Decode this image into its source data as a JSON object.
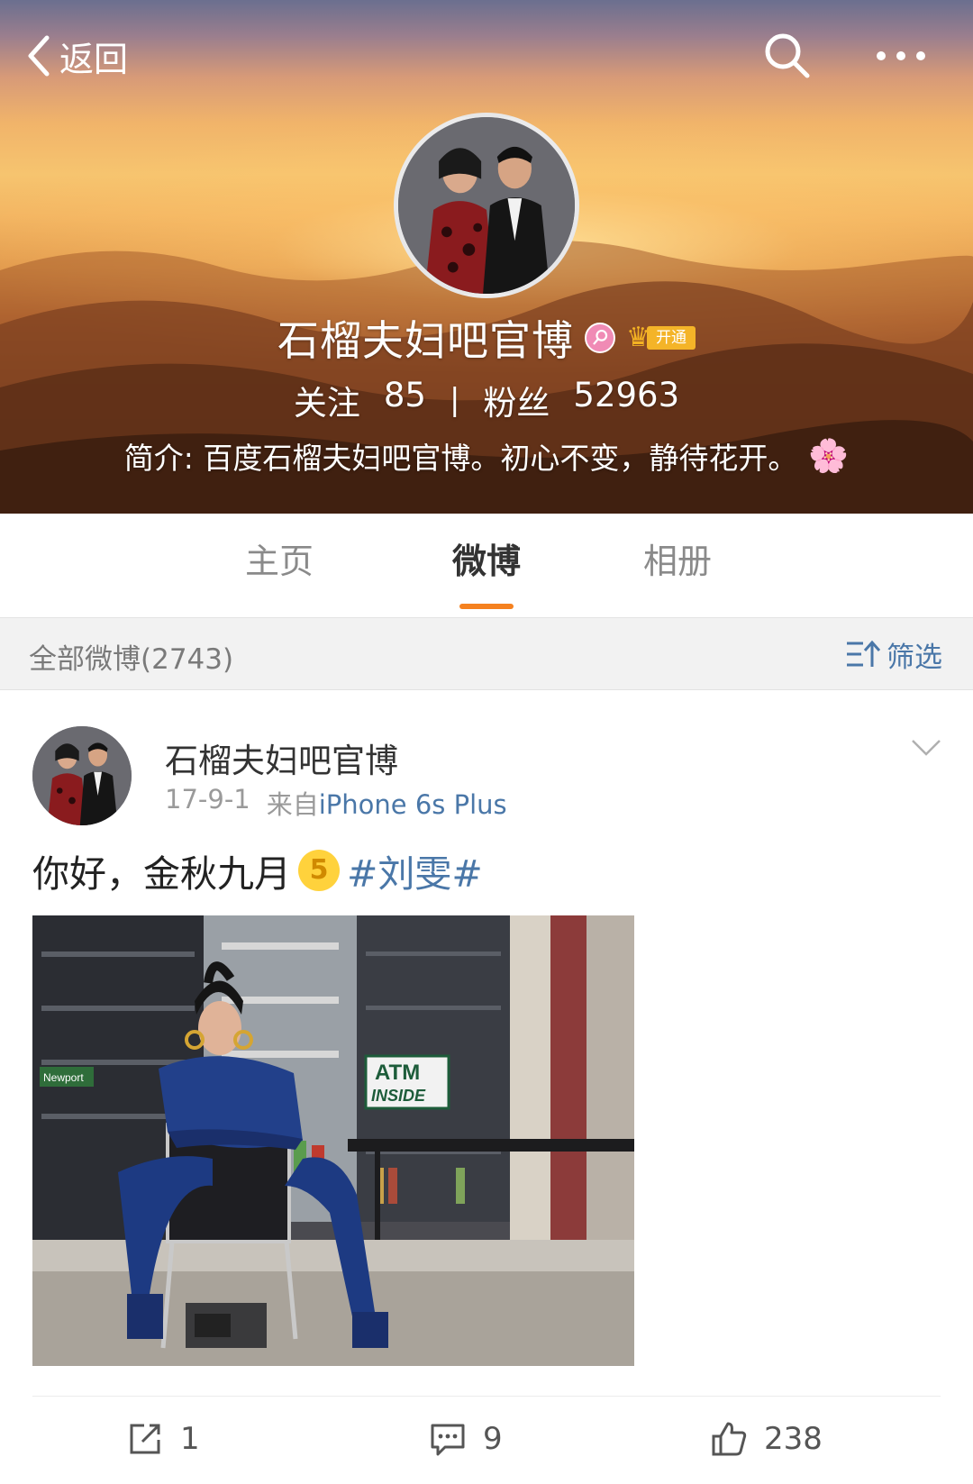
{
  "nav": {
    "back_label": "返回"
  },
  "profile": {
    "name": "石榴夫妇吧官博",
    "member_tag": "开通",
    "following_label": "关注",
    "following_count": "85",
    "stats_divider": "|",
    "followers_label": "粉丝",
    "followers_count": "52963",
    "bio": "简介: 百度石榴夫妇吧官博。初心不变，静待花开。",
    "bio_emoji": "🌸"
  },
  "tabs": [
    {
      "label": "主页",
      "active": false
    },
    {
      "label": "微博",
      "active": true
    },
    {
      "label": "相册",
      "active": false
    }
  ],
  "filter": {
    "count_label": "全部微博(2743)",
    "filter_label": "筛选"
  },
  "post": {
    "author": "石榴夫妇吧官博",
    "date": "17-9-1",
    "source_prefix": "来自",
    "source": "iPhone 6s Plus",
    "text": "你好，金秋九月",
    "emoji_digit": "5",
    "hashtag": "#刘雯#",
    "image_sign_line1": "ATM",
    "image_sign_line2": "INSIDE",
    "image_sign_small": "Newport",
    "reposts": "1",
    "comments": "9",
    "likes": "238"
  },
  "colors": {
    "accent_orange": "#f5811f",
    "link_blue": "#4a77a8",
    "member_gold": "#f4b428",
    "vip_pink": "#f08bb5"
  }
}
